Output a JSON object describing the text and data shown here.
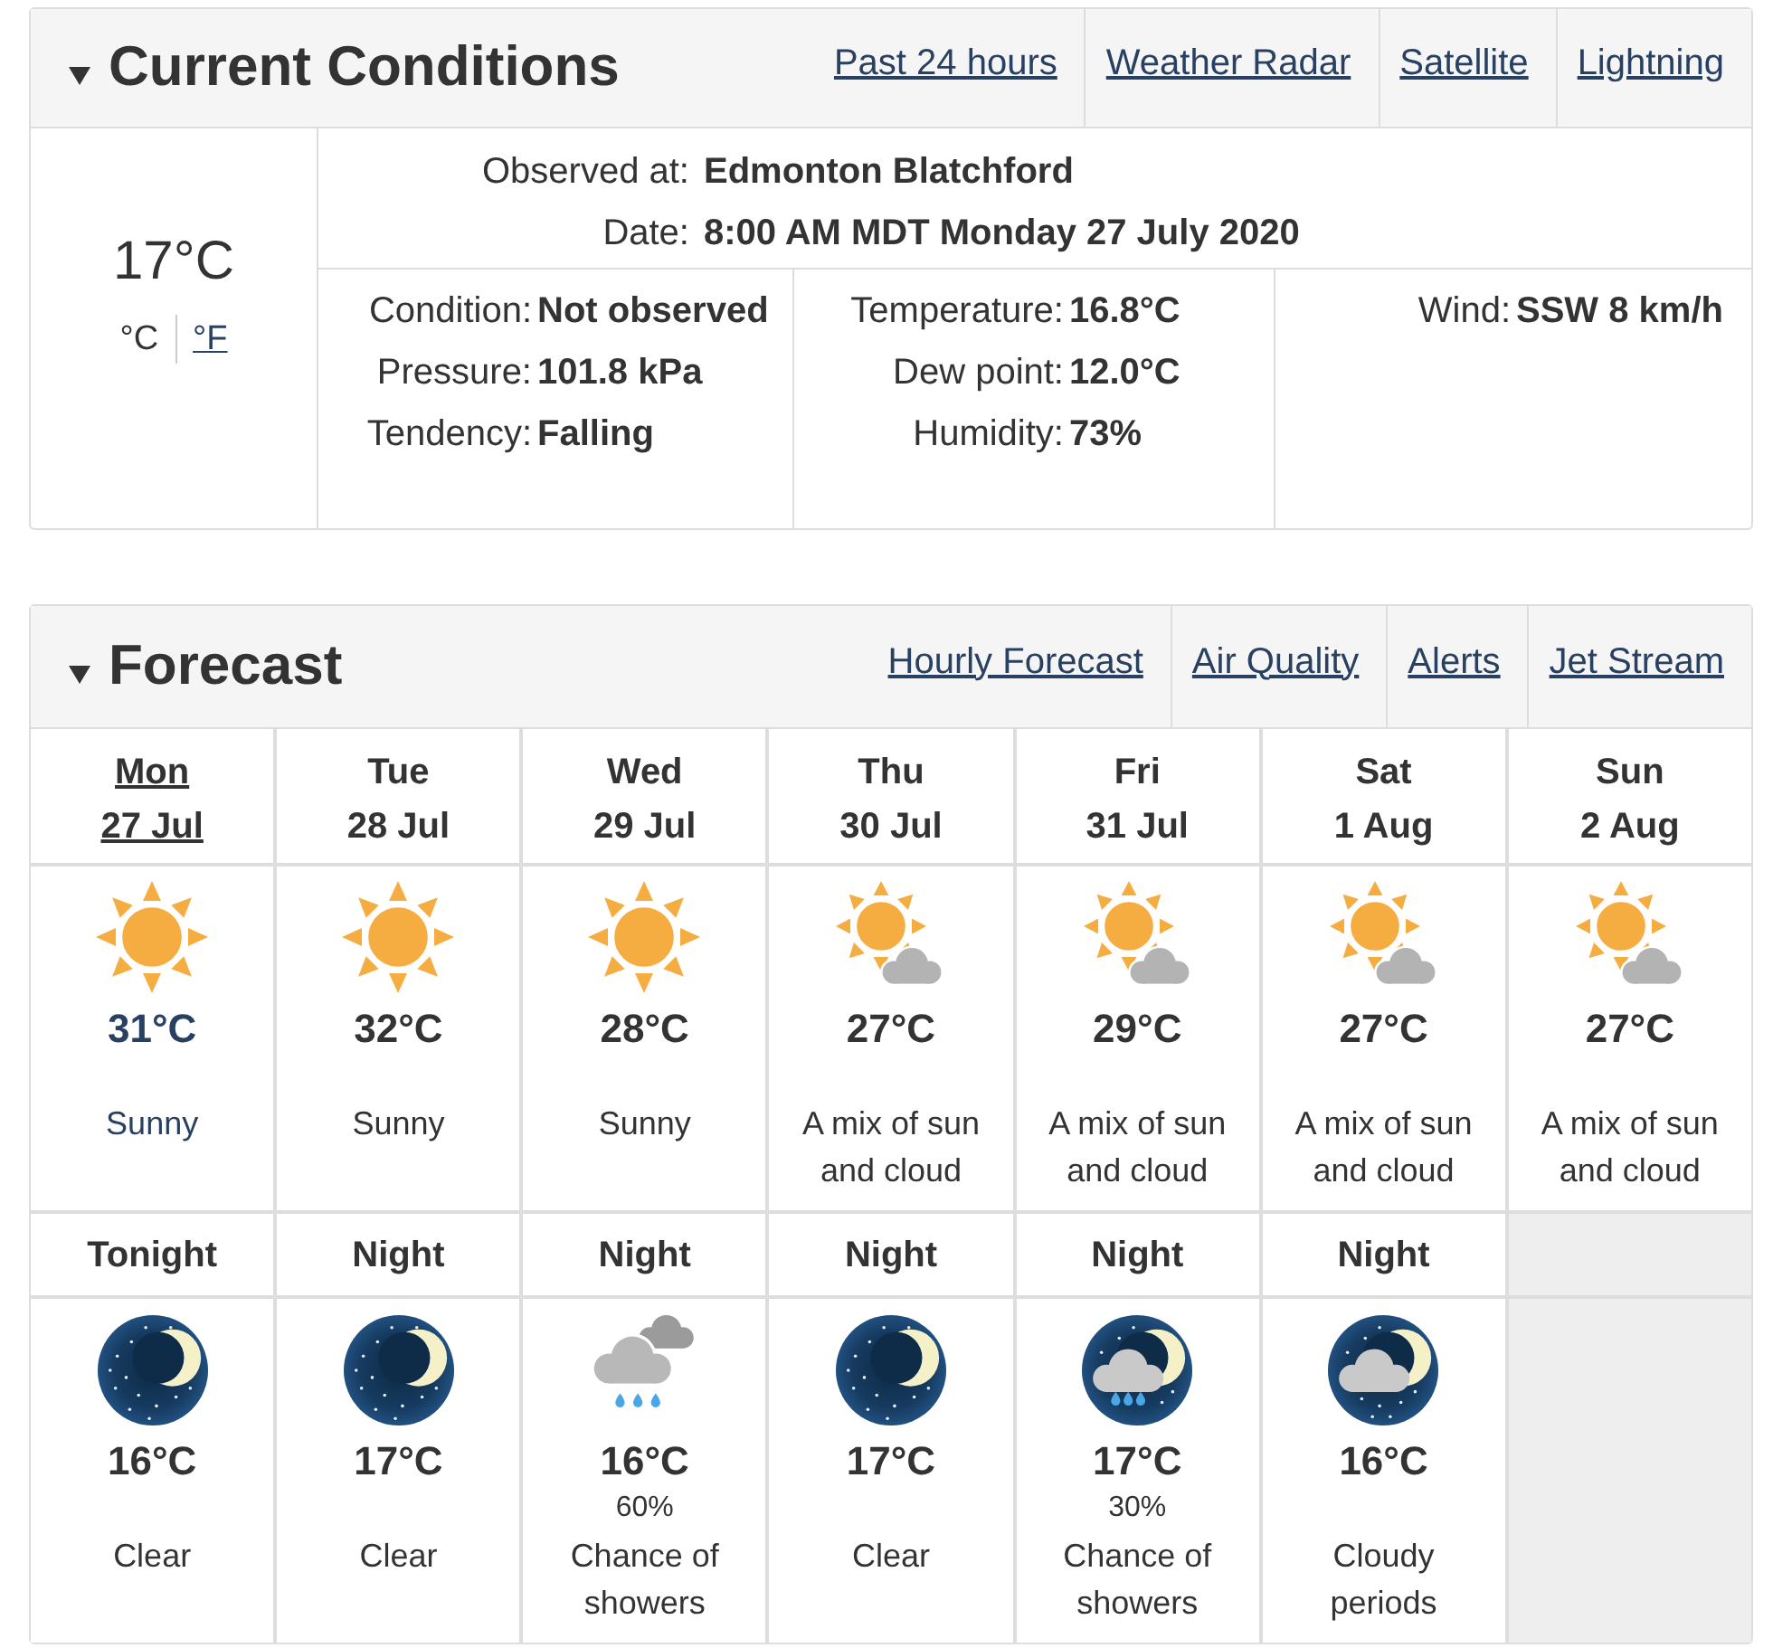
{
  "current_conditions": {
    "title": "Current Conditions",
    "expanded": true,
    "links": [
      "Past 24 hours",
      "Weather Radar",
      "Satellite",
      "Lightning"
    ],
    "temperature": "17°C",
    "units": [
      {
        "label": "°C",
        "selected": true
      },
      {
        "label": "°F",
        "selected": false
      }
    ],
    "station": [
      {
        "label": "Observed at:",
        "value": "Edmonton Blatchford"
      },
      {
        "label": "Date:",
        "value": "8:00 AM MDT Monday 27 July 2020"
      }
    ],
    "columns": [
      {
        "rows": [
          {
            "label": "Condition:",
            "value": "Not observed"
          },
          {
            "label": "Pressure:",
            "value": "101.8 kPa"
          },
          {
            "label": "Tendency:",
            "value": "Falling"
          }
        ]
      },
      {
        "rows": [
          {
            "label": "Temperature:",
            "value": "16.8°C"
          },
          {
            "label": "Dew point:",
            "value": "12.0°C"
          },
          {
            "label": "Humidity:",
            "value": "73%"
          }
        ]
      },
      {
        "rows": [
          {
            "label": "Wind:",
            "value": "SSW 8 km/h"
          }
        ]
      }
    ]
  },
  "forecast": {
    "title": "Forecast",
    "expanded": true,
    "links": [
      "Hourly Forecast",
      "Air Quality",
      "Alerts",
      "Jet Stream"
    ],
    "days": [
      {
        "day": "Mon",
        "date": "27 Jul",
        "today": true,
        "kind": "sunny",
        "temperature": "31°C",
        "condition": "Sunny",
        "night": {
          "label": "Tonight",
          "kind": "clear_night",
          "temperature": "16°C",
          "condition": "Clear"
        }
      },
      {
        "day": "Tue",
        "date": "28 Jul",
        "today": false,
        "kind": "sunny",
        "temperature": "32°C",
        "condition": "Sunny",
        "night": {
          "label": "Night",
          "kind": "clear_night",
          "temperature": "17°C",
          "condition": "Clear"
        }
      },
      {
        "day": "Wed",
        "date": "29 Jul",
        "today": false,
        "kind": "sunny",
        "temperature": "28°C",
        "condition": "Sunny",
        "night": {
          "label": "Night",
          "kind": "showers",
          "temperature": "16°C",
          "pop": "60%",
          "condition": "Chance of showers"
        }
      },
      {
        "day": "Thu",
        "date": "30 Jul",
        "today": false,
        "kind": "mix",
        "temperature": "27°C",
        "condition": "A mix of sun and cloud",
        "night": {
          "label": "Night",
          "kind": "clear_night",
          "temperature": "17°C",
          "condition": "Clear"
        }
      },
      {
        "day": "Fri",
        "date": "31 Jul",
        "today": false,
        "kind": "mix",
        "temperature": "29°C",
        "condition": "A mix of sun and cloud",
        "night": {
          "label": "Night",
          "kind": "night_showers",
          "temperature": "17°C",
          "pop": "30%",
          "condition": "Chance of showers"
        }
      },
      {
        "day": "Sat",
        "date": "1 Aug",
        "today": false,
        "kind": "mix",
        "temperature": "27°C",
        "condition": "A mix of sun and cloud",
        "night": {
          "label": "Night",
          "kind": "night_cloudy",
          "temperature": "16°C",
          "condition": "Cloudy periods"
        }
      },
      {
        "day": "Sun",
        "date": "2 Aug",
        "today": false,
        "kind": "mix",
        "temperature": "27°C",
        "condition": "A mix of sun and cloud"
      }
    ]
  }
}
